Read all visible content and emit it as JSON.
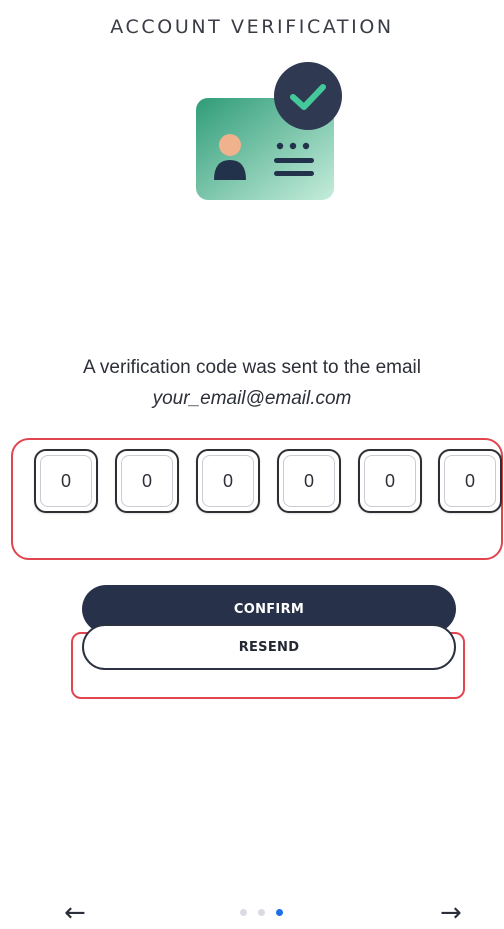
{
  "header": {
    "title": "ACCOUNT VERIFICATION"
  },
  "illustration": {
    "icon": "id-card-verified-icon",
    "colors": {
      "card_start": "#2f9c78",
      "card_end": "#bde7d4",
      "badge": "#2f3a52",
      "check": "#45c99a",
      "avatar_head": "#f0b28c",
      "avatar_body": "#22324a"
    }
  },
  "verification": {
    "message": "A verification code was sent to the email",
    "email": "your_email@email.com",
    "code_digits": [
      "0",
      "0",
      "0",
      "0",
      "0",
      "0"
    ]
  },
  "actions": {
    "confirm_label": "CONFIRM",
    "resend_label": "RESEND"
  },
  "navigation": {
    "back_icon": "arrow-left-icon",
    "back_glyph": "←",
    "next_icon": "arrow-right-icon",
    "next_glyph": "→",
    "page_indicator": {
      "total": 3,
      "active_index": 2
    }
  },
  "colors": {
    "primary": "#27324a",
    "highlight": "#e2454f",
    "active_dot": "#1f6fe6",
    "inactive_dot": "#d8dbe2"
  }
}
